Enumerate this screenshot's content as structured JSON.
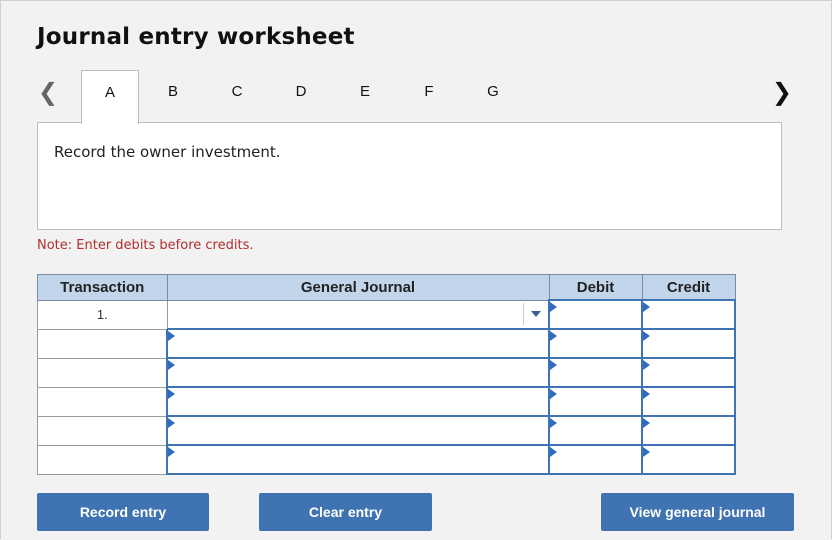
{
  "title": "Journal entry worksheet",
  "tabs": [
    "A",
    "B",
    "C",
    "D",
    "E",
    "F",
    "G"
  ],
  "active_tab": "A",
  "prompt": "Record the owner investment.",
  "note": "Note: Enter debits before credits.",
  "table": {
    "headers": {
      "transaction": "Transaction",
      "journal": "General Journal",
      "debit": "Debit",
      "credit": "Credit"
    },
    "rows": [
      {
        "transaction": "1."
      },
      {
        "transaction": ""
      },
      {
        "transaction": ""
      },
      {
        "transaction": ""
      },
      {
        "transaction": ""
      },
      {
        "transaction": ""
      }
    ]
  },
  "buttons": {
    "record": "Record entry",
    "clear": "Clear entry",
    "view": "View general journal"
  },
  "colors": {
    "button": "#3f73b1",
    "header": "#c3d5ea",
    "note": "#b03030"
  },
  "icons": {
    "prev": "chevron-left-icon",
    "next": "chevron-right-icon",
    "dropdown": "caret-down-icon"
  }
}
